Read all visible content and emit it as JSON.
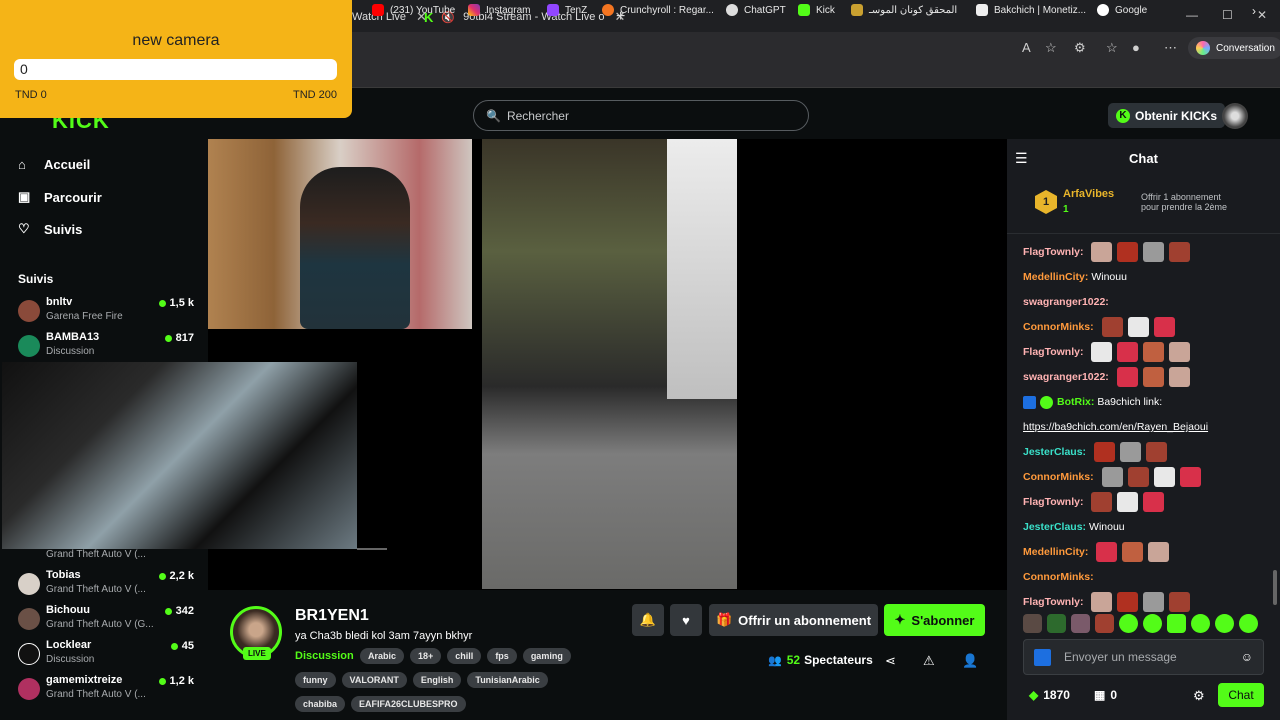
{
  "overlay": {
    "title": "new camera",
    "value": "0",
    "min_label": "TND 0",
    "max_label": "TND 200",
    "fill_fraction": 0
  },
  "browser": {
    "tabs": [
      {
        "label": "Watch Live"
      },
      {
        "label": "9otbi4 Stream - Watch Live o"
      }
    ],
    "conversation_label": "Conversation",
    "bookmarks": [
      "(231) YouTube",
      "Instagram",
      "TenZ",
      "Crunchyroll : Regar...",
      "ChatGPT",
      "Kick",
      "المحقق كونان الموسـ",
      "Bakchich | Monetiz...",
      "Google"
    ]
  },
  "site": {
    "logo": "KICK",
    "search_placeholder": "Rechercher",
    "kicks_button": "Obtenir KICKs"
  },
  "nav": [
    {
      "label": "Accueil"
    },
    {
      "label": "Parcourir"
    },
    {
      "label": "Suivis"
    }
  ],
  "following": {
    "heading": "Suivis",
    "channels": [
      {
        "name": "bnltv",
        "category": "Garena Free Fire",
        "viewers": "1,5 k"
      },
      {
        "name": "BAMBA13",
        "category": "Discussion",
        "viewers": "817"
      },
      {
        "name": "",
        "category": "Grand Theft Auto V (...",
        "viewers": ""
      },
      {
        "name": "Tobias",
        "category": "Grand Theft Auto V (...",
        "viewers": "2,2 k"
      },
      {
        "name": "Bichouu",
        "category": "Grand Theft Auto V (G...",
        "viewers": "342"
      },
      {
        "name": "Locklear",
        "category": "Discussion",
        "viewers": "45"
      },
      {
        "name": "gamemixtreize",
        "category": "Grand Theft Auto V (...",
        "viewers": "1,2 k"
      }
    ]
  },
  "stream": {
    "streamer": "BR1YEN1",
    "live_badge": "LIVE",
    "title": "ya Cha3b bledi kol 3am 7ayyn bkhyr",
    "category": "Discussion",
    "tags_row1": [
      "Arabic",
      "18+",
      "chill",
      "fps",
      "gaming"
    ],
    "tags_row2": [
      "funny",
      "VALORANT",
      "English",
      "TunisianArabic"
    ],
    "tags_row3": [
      "chabiba",
      "EAFIFA26CLUBESPRO"
    ],
    "gift_label": "Offrir un abonnement",
    "subscribe_label": "S'abonner",
    "viewers_count": "52",
    "viewers_label": "Spectateurs"
  },
  "chat": {
    "title": "Chat",
    "pinned": {
      "user": "ArfaVibes",
      "badge_number": "1",
      "count": "1",
      "info_line1": "Offrir 1 abonnement",
      "info_line2": "pour prendre la 2ème"
    },
    "messages": [
      {
        "user": "FlagTownly:",
        "text": "",
        "color": "#ffb3b3",
        "emotes": 4
      },
      {
        "user": "MedellinCity:",
        "text": "Winouu",
        "color": "#ff9a3c",
        "emotes": 0
      },
      {
        "user": "swagranger1022:",
        "text": "",
        "color": "#ffb3b3",
        "emotes": 0
      },
      {
        "user": "ConnorMinks:",
        "text": "",
        "color": "#ff9a3c",
        "emotes": 3
      },
      {
        "user": "FlagTownly:",
        "text": "",
        "color": "#ffb3b3",
        "emotes": 4
      },
      {
        "user": "swagranger1022:",
        "text": "",
        "color": "#ffb3b3",
        "emotes": 3
      },
      {
        "user": "BotRix:",
        "text": "Ba9chich link:",
        "color": "#53fc18",
        "emotes": 0
      },
      {
        "user": "",
        "text": "https://ba9chich.com/en/Rayen_Bejaoui",
        "color": "#ffffff",
        "emotes": 0
      },
      {
        "user": "JesterClaus:",
        "text": "",
        "color": "#3ae0c9",
        "emotes": 3
      },
      {
        "user": "ConnorMinks:",
        "text": "",
        "color": "#ff9a3c",
        "emotes": 4
      },
      {
        "user": "FlagTownly:",
        "text": "",
        "color": "#ffb3b3",
        "emotes": 3
      },
      {
        "user": "JesterClaus:",
        "text": "Winouu",
        "color": "#3ae0c9",
        "emotes": 0
      },
      {
        "user": "MedellinCity:",
        "text": "",
        "color": "#ff9a3c",
        "emotes": 3
      },
      {
        "user": "ConnorMinks:",
        "text": "",
        "color": "#ff9a3c",
        "emotes": 0
      },
      {
        "user": "FlagTownly:",
        "text": "",
        "color": "#ffb3b3",
        "emotes": 4
      }
    ],
    "input_placeholder": "Envoyer un message",
    "kicks_balance": "1870",
    "points_balance": "0",
    "chat_button": "Chat"
  },
  "colors": {
    "accent": "#53fc18",
    "overlay": "#f5b417",
    "background": "#0b0e0f",
    "chat_bg": "#191b1f"
  }
}
